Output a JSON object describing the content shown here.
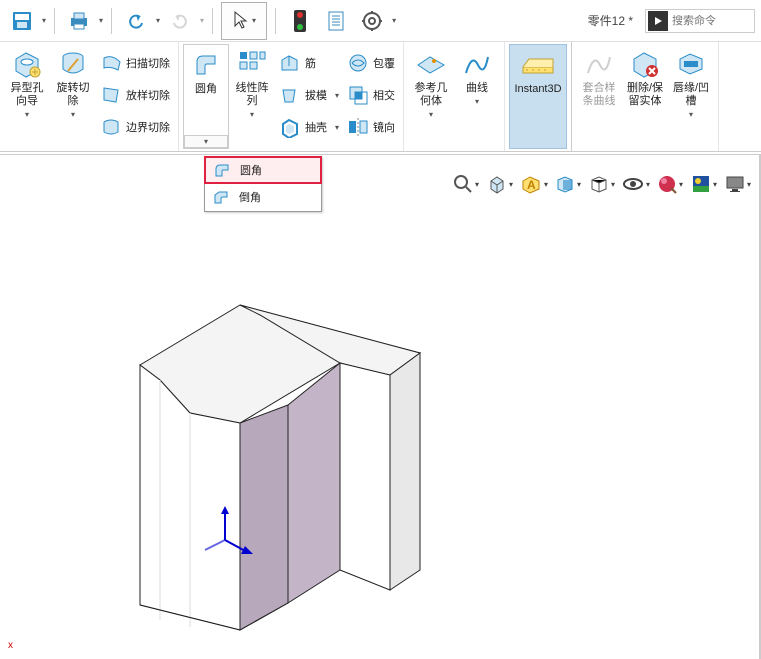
{
  "qat": {
    "title": "零件12 *",
    "search_placeholder": "搜索命令"
  },
  "ribbon": {
    "hole_wizard": "异型孔\n向导",
    "rev_cut": "旋转切\n除",
    "sweep_cut": "扫描切除",
    "loft_cut": "放样切除",
    "boundary_cut": "边界切除",
    "fillet": "圆角",
    "linear_pattern": "线性阵\n列",
    "rib": "筋",
    "draft": "拔模",
    "shell": "抽壳",
    "wrap": "包覆",
    "intersect": "相交",
    "mirror": "镜向",
    "refgeom": "参考几\n何体",
    "curves": "曲线",
    "instant3d": "Instant3D",
    "combine": "套合样\n条曲线",
    "delete_keep": "删除/保\n留实体",
    "lip_groove": "唇缘/凹\n槽"
  },
  "dropdown": {
    "fillet": "圆角",
    "chamfer": "倒角"
  }
}
